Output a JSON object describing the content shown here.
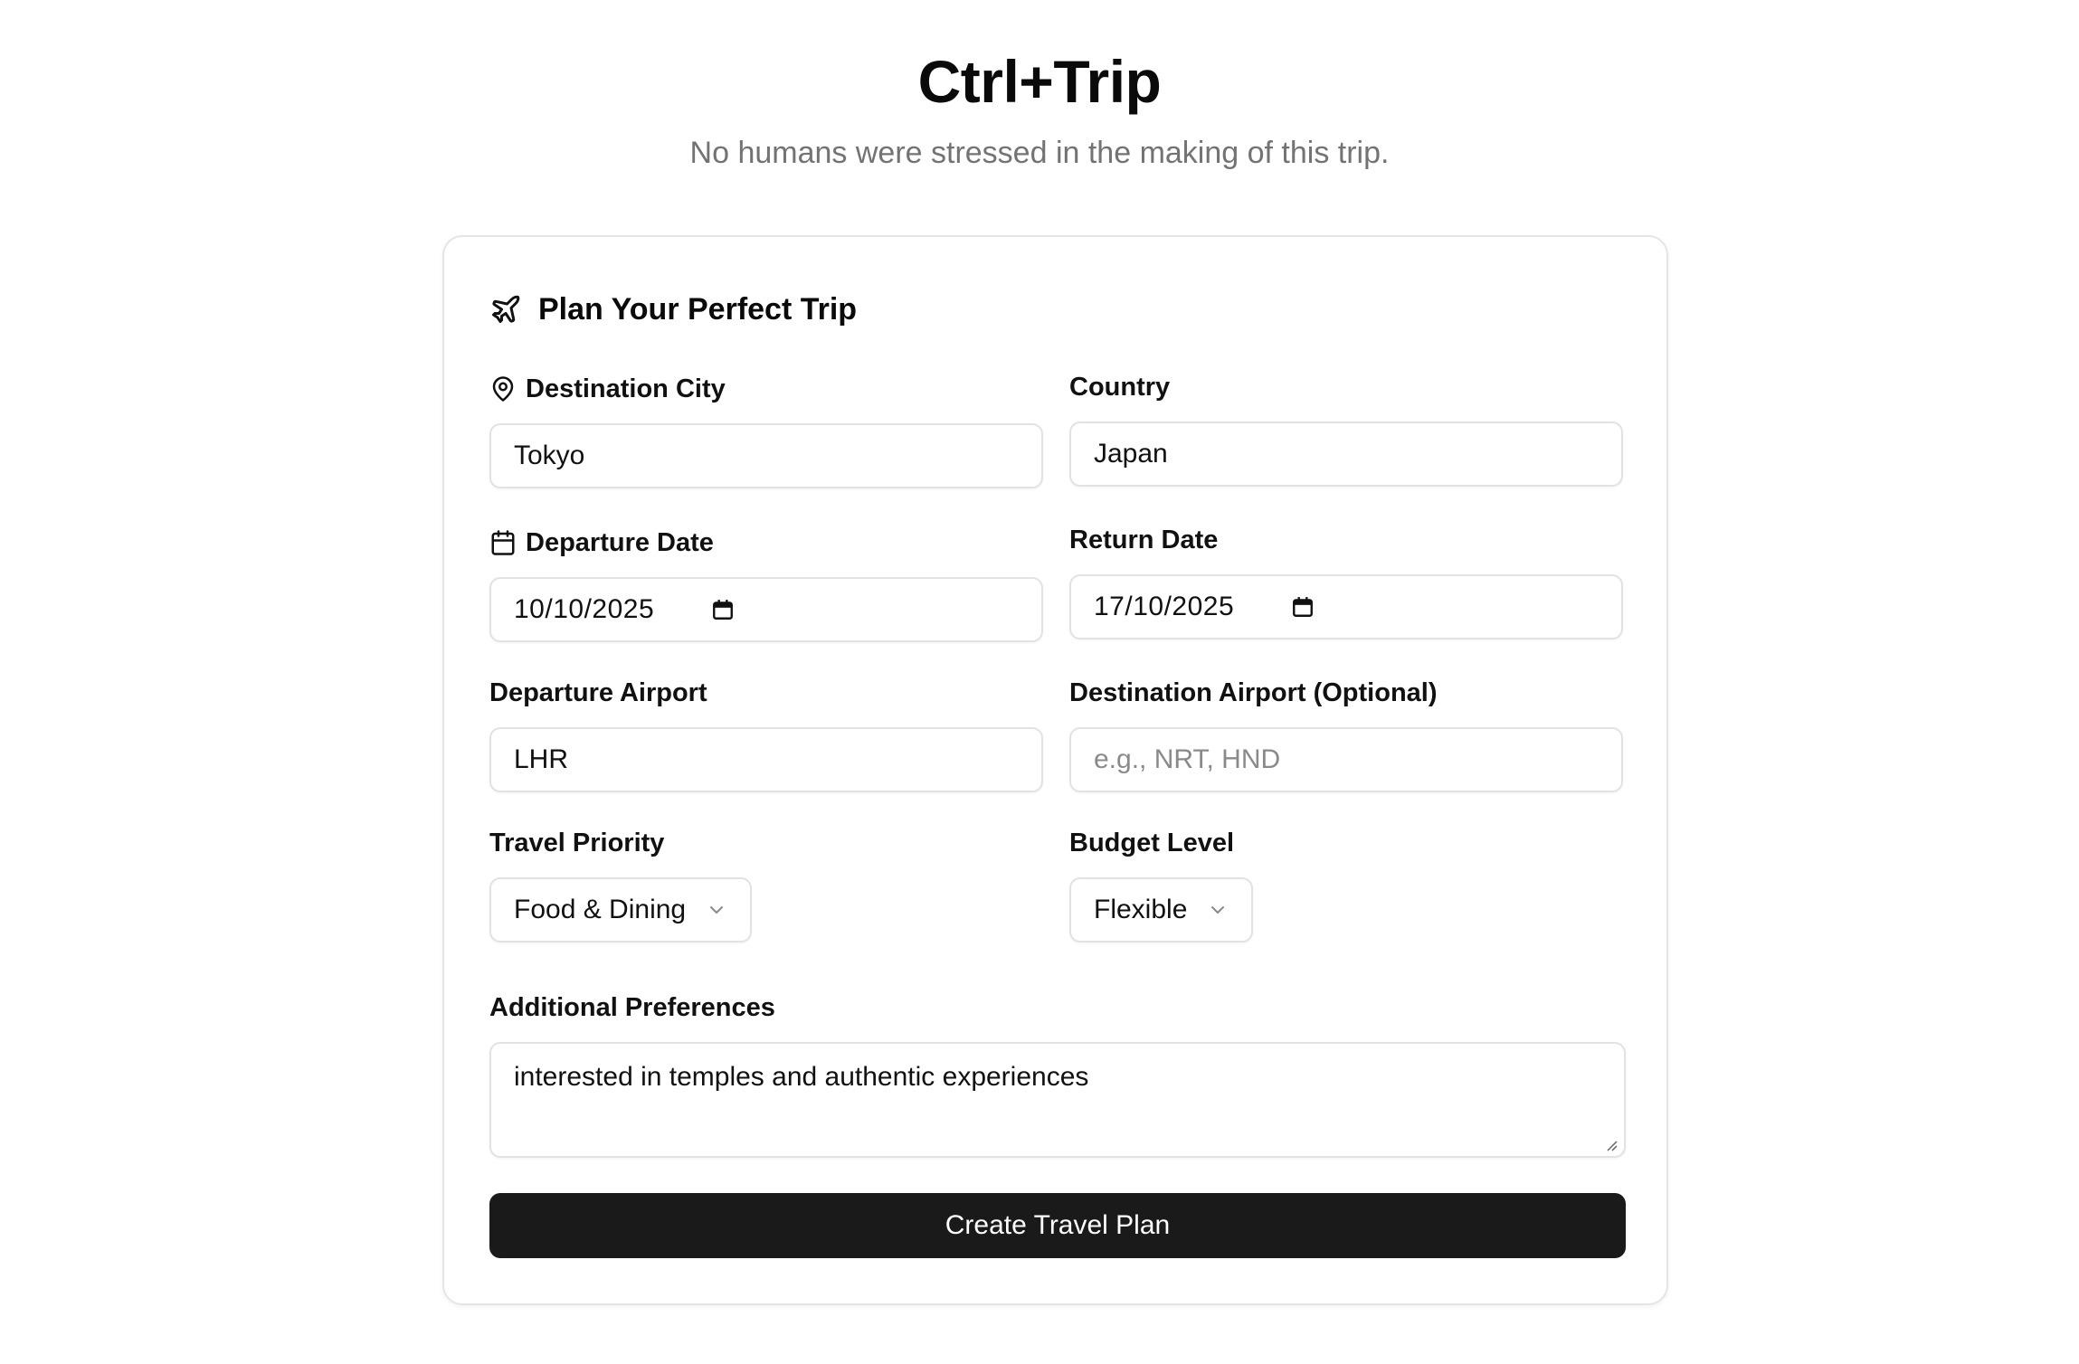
{
  "header": {
    "title": "Ctrl+Trip",
    "subtitle": "No humans were stressed in the making of this trip."
  },
  "card": {
    "title": "Plan Your Perfect Trip",
    "icon": "plane-icon"
  },
  "form": {
    "destination_city": {
      "label": "Destination City",
      "icon": "map-pin-icon",
      "value": "Tokyo"
    },
    "country": {
      "label": "Country",
      "value": "Japan"
    },
    "departure_date": {
      "label": "Departure Date",
      "icon": "calendar-icon",
      "value": "10/10/2025"
    },
    "return_date": {
      "label": "Return Date",
      "value": "17/10/2025"
    },
    "departure_airport": {
      "label": "Departure Airport",
      "value": "LHR"
    },
    "destination_airport": {
      "label": "Destination Airport (Optional)",
      "placeholder": "e.g., NRT, HND"
    },
    "travel_priority": {
      "label": "Travel Priority",
      "selected": "Food & Dining"
    },
    "budget_level": {
      "label": "Budget Level",
      "selected": "Flexible"
    },
    "additional_preferences": {
      "label": "Additional Preferences",
      "value": "interested in temples and authentic experiences"
    },
    "submit_label": "Create Travel Plan"
  },
  "colors": {
    "button_bg": "#1a1a1a",
    "border": "#e2e2e2",
    "subtitle": "#737373"
  }
}
